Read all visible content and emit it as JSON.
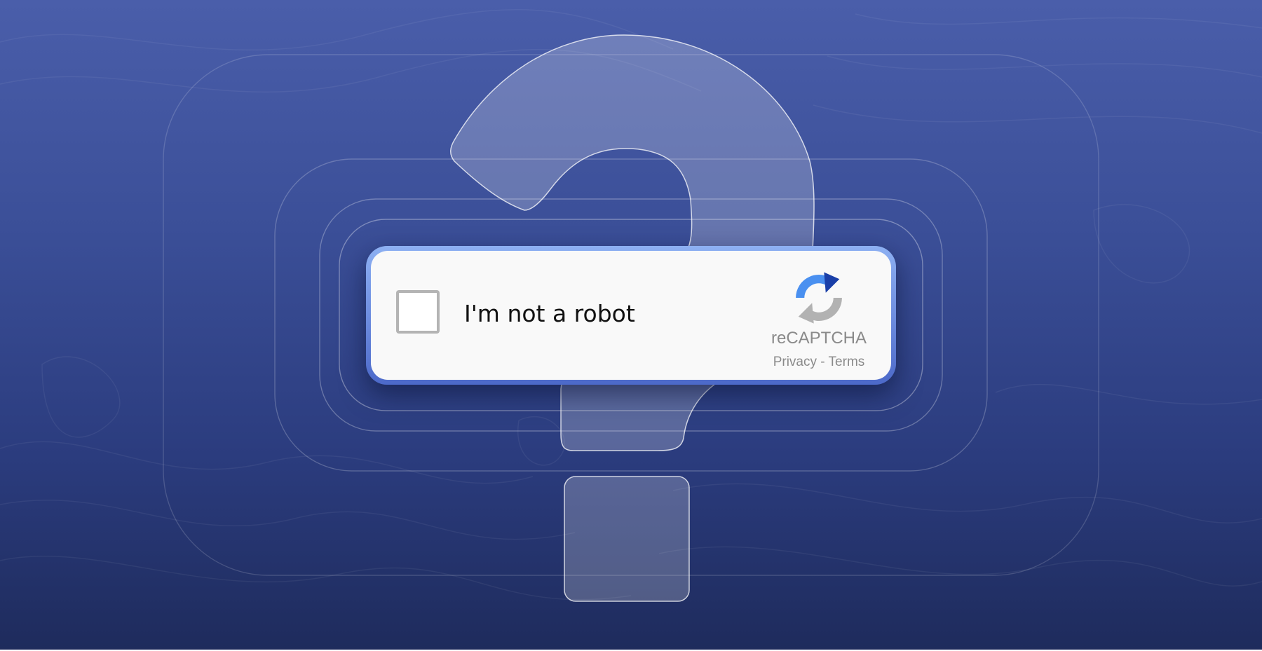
{
  "captcha": {
    "checkbox_checked": false,
    "label": "I'm not a robot",
    "brand": "reCAPTCHA",
    "privacy_link": "Privacy",
    "separator": "-",
    "terms_link": "Terms"
  },
  "icons": {
    "background": "question-mark-icon",
    "logo": "recaptcha-logo-icon"
  },
  "colors": {
    "background_top": "#4a5eaa",
    "background_bottom": "#1e2b5c",
    "card_border_top": "#8db0f2",
    "card_border_bottom": "#4c69c9",
    "card_fill": "#f9f9f9",
    "text_muted": "#8a8a8a",
    "logo_blue": "#4a90f0",
    "logo_dark_blue": "#1a3fa8",
    "logo_gray": "#b2b2b2"
  }
}
